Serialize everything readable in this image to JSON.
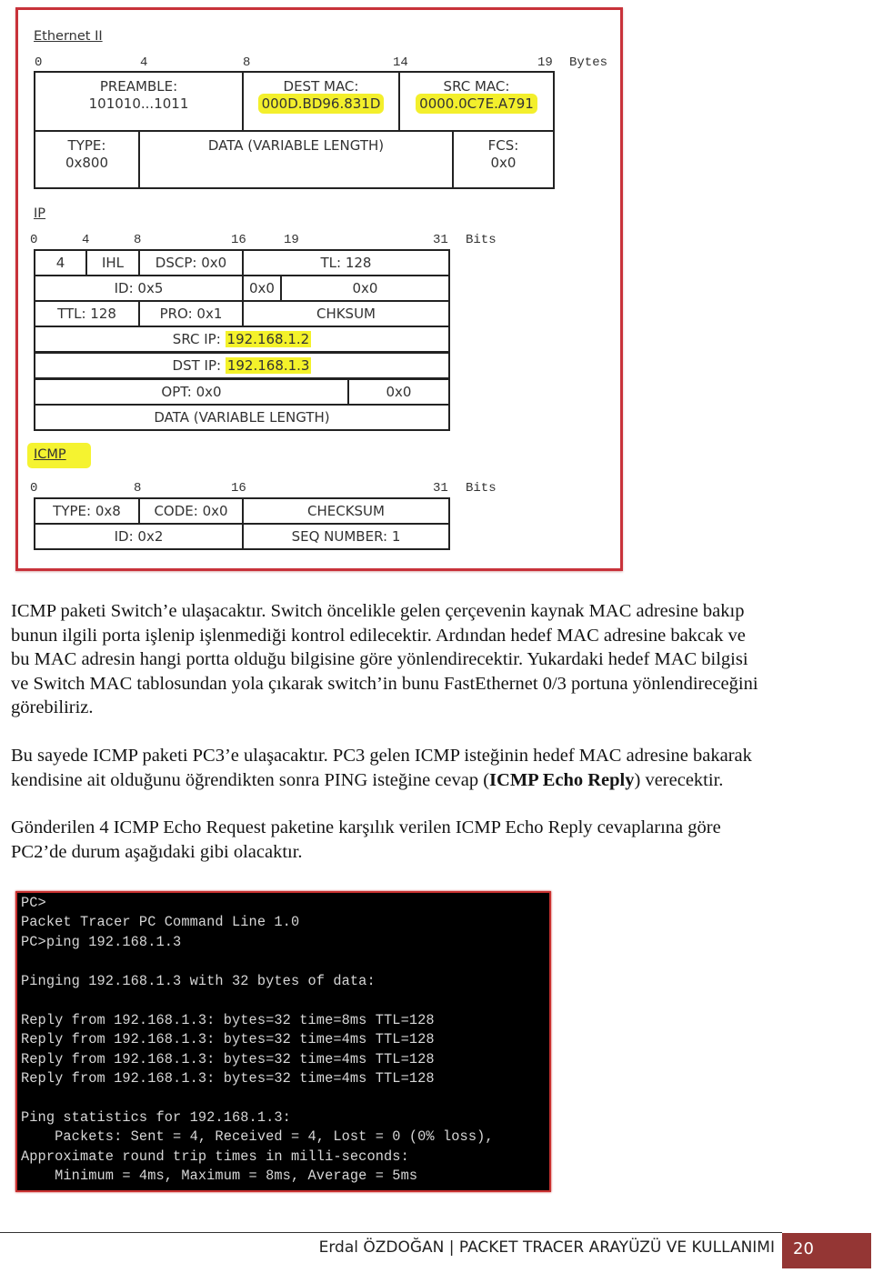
{
  "diagram": {
    "ethernet": {
      "title": "Ethernet II",
      "ruler": [
        "0",
        "4",
        "8",
        "14",
        "19"
      ],
      "unit": "Bytes",
      "fields": {
        "preamble_label": "PREAMBLE:",
        "preamble_value": "101010...1011",
        "dest_mac_label": "DEST MAC:",
        "dest_mac_value": "000D.BD96.831D",
        "src_mac_label": "SRC MAC:",
        "src_mac_value": "0000.0C7E.A791",
        "type_label": "TYPE:",
        "type_value": "0x800",
        "data": "DATA (VARIABLE LENGTH)",
        "fcs_label": "FCS:",
        "fcs_value": "0x0"
      }
    },
    "ip": {
      "title": "IP",
      "ruler": [
        "0",
        "4",
        "8",
        "16",
        "19",
        "31"
      ],
      "unit": "Bits",
      "fields": {
        "version": "4",
        "ihl": "IHL",
        "dscp": "DSCP: 0x0",
        "tl": "TL: 128",
        "id": "ID: 0x5",
        "flags": "0x0",
        "frag_offset": "0x0",
        "ttl": "TTL: 128",
        "protocol": "PRO: 0x1",
        "checksum": "CHKSUM",
        "src_ip_label": "SRC IP:",
        "src_ip_value": "192.168.1.2",
        "dst_ip_label": "DST IP:",
        "dst_ip_value": "192.168.1.3",
        "options": "OPT: 0x0",
        "padding": "0x0",
        "data": "DATA (VARIABLE LENGTH)"
      }
    },
    "icmp": {
      "title": "ICMP",
      "ruler": [
        "0",
        "8",
        "16",
        "31"
      ],
      "unit": "Bits",
      "fields": {
        "type": "TYPE: 0x8",
        "code": "CODE: 0x0",
        "checksum": "CHECKSUM",
        "id": "ID: 0x2",
        "seq": "SEQ NUMBER: 1"
      }
    }
  },
  "paragraphs": {
    "p1": [
      "ICMP paketi Switch’e ulaşacaktır. Switch öncelikle gelen çerçevenin kaynak MAC adresine bakıp",
      "bunun ilgili porta işlenip işlenmediği kontrol edilecektir. Ardından hedef MAC adresine bakcak ve",
      "bu MAC adresin hangi portta olduğu bilgisine göre yönlendirecektir. Yukardaki hedef MAC bilgisi",
      "ve Switch MAC tablosundan yola çıkarak switch’in bunu FastEthernet 0/3 portuna yönlendireceğini",
      "görebiliriz."
    ],
    "p2": {
      "line1": "Bu sayede ICMP paketi PC3’e ulaşacaktır. PC3 gelen ICMP isteğinin hedef MAC adresine bakarak",
      "line2_before": "kendisine ait olduğunu öğrendikten sonra PING isteğine cevap (",
      "line2_bold": "ICMP Echo Reply",
      "line2_after": ") verecektir."
    },
    "p3": [
      "Gönderilen 4 ICMP Echo Request paketine karşılık verilen ICMP Echo Reply cevaplarına göre",
      "PC2’de durum aşağıdaki gibi olacaktır."
    ]
  },
  "terminal": {
    "lines": [
      "PC>",
      "Packet Tracer PC Command Line 1.0",
      "PC>ping 192.168.1.3",
      "",
      "Pinging 192.168.1.3 with 32 bytes of data:",
      "",
      "Reply from 192.168.1.3: bytes=32 time=8ms TTL=128",
      "Reply from 192.168.1.3: bytes=32 time=4ms TTL=128",
      "Reply from 192.168.1.3: bytes=32 time=4ms TTL=128",
      "Reply from 192.168.1.3: bytes=32 time=4ms TTL=128",
      "",
      "Ping statistics for 192.168.1.3:",
      "    Packets: Sent = 4, Received = 4, Lost = 0 (0% loss),",
      "Approximate round trip times in milli-seconds:",
      "    Minimum = 4ms, Maximum = 8ms, Average = 5ms"
    ]
  },
  "footer": {
    "text": "Erdal ÖZDOĞAN | PACKET TRACER ARAYÜZÜ VE KULLANIMI",
    "page_number": "20",
    "accent_color": "#943634"
  }
}
